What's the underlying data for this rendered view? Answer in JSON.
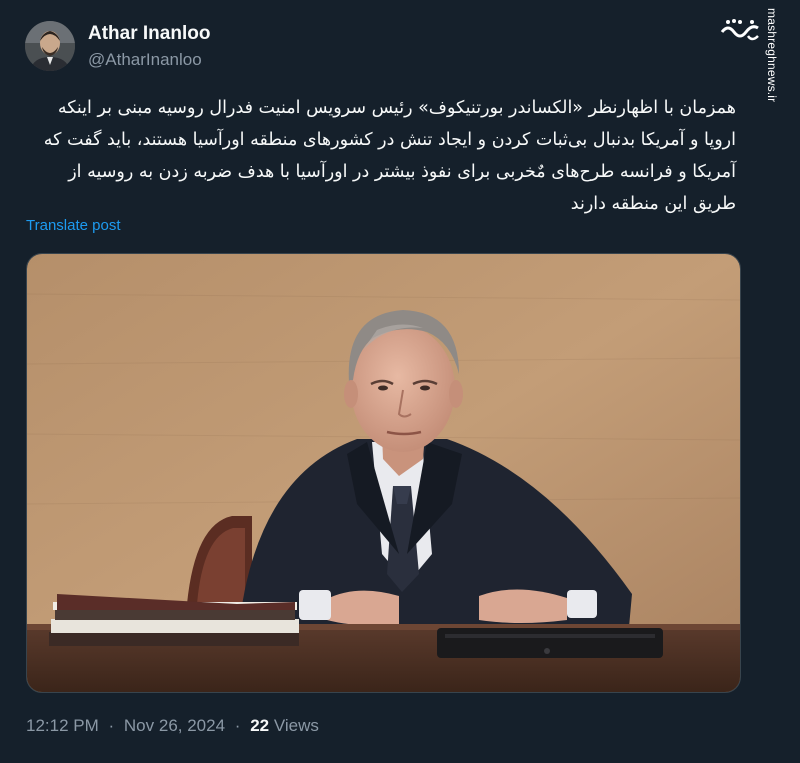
{
  "author": {
    "name": "Athar Inanloo",
    "handle": "@AtharInanloo"
  },
  "watermark": {
    "logo_text": "مشرق",
    "site": "mashreghnews.ir"
  },
  "post": {
    "text": "همزمان با اظهارنظر «الکساندر بورتنیکوف» رئیس سرویس امنیت فدرال روسیه مبنی بر اینکه اروپا و آمریکا بدنبال بی‌ثبات کردن و ایجاد تنش در کشورهای منطقه اورآسیا هستند، باید گفت که آمریکا و فرانسه طرح‌های مٌخربی برای نفوذ بیشتر در اورآسیا با هدف ضربه زدن به روسیه از طریق این منطقه دارند",
    "translate_label": "Translate post"
  },
  "meta": {
    "time": "12:12 PM",
    "date": "Nov 26, 2024",
    "separator": "·",
    "views_count": "22",
    "views_label": "Views"
  },
  "colors": {
    "background": "#15202b",
    "link": "#1d9bf0",
    "secondary_text": "#8b98a5"
  }
}
